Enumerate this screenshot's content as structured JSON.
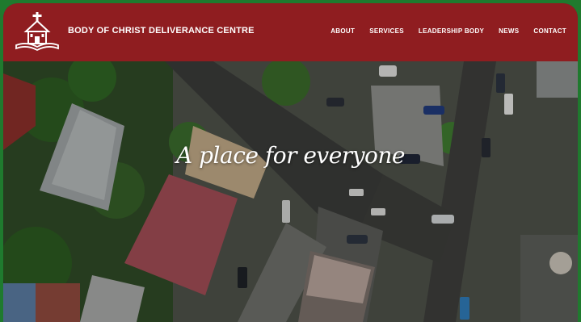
{
  "site": {
    "title": "BODY OF CHRIST DELIVERANCE CENTRE"
  },
  "nav": {
    "items": [
      {
        "label": "ABOUT"
      },
      {
        "label": "SERVICES"
      },
      {
        "label": "LEADERSHIP BODY"
      },
      {
        "label": "NEWS"
      },
      {
        "label": "CONTACT"
      }
    ]
  },
  "hero": {
    "tagline": "A place for everyone"
  },
  "colors": {
    "header": "#8f1d20",
    "border": "#1f7a2e"
  }
}
